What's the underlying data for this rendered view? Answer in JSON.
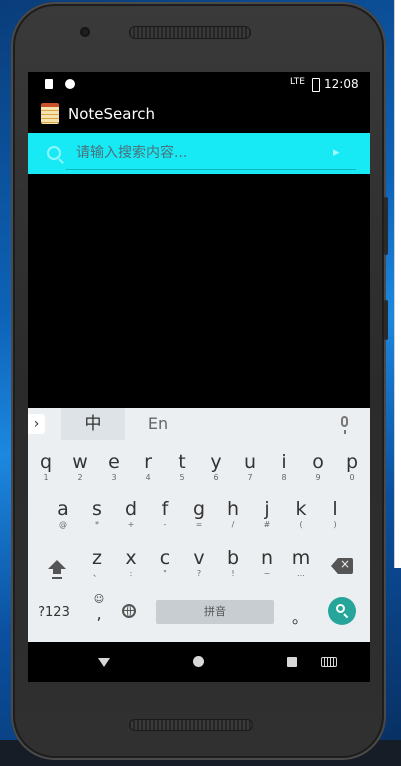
{
  "status_bar": {
    "network": "LTE",
    "time": "12:08"
  },
  "app": {
    "title": "NoteSearch"
  },
  "search": {
    "placeholder": "请输入搜索内容...",
    "value": ""
  },
  "keyboard": {
    "lang_zh": "中",
    "lang_en": "En",
    "expand": "›",
    "rows": [
      [
        {
          "k": "q",
          "s": "1"
        },
        {
          "k": "w",
          "s": "2"
        },
        {
          "k": "e",
          "s": "3"
        },
        {
          "k": "r",
          "s": "4"
        },
        {
          "k": "t",
          "s": "5"
        },
        {
          "k": "y",
          "s": "6"
        },
        {
          "k": "u",
          "s": "7"
        },
        {
          "k": "i",
          "s": "8"
        },
        {
          "k": "o",
          "s": "9"
        },
        {
          "k": "p",
          "s": "0"
        }
      ],
      [
        {
          "k": "a",
          "s": "@"
        },
        {
          "k": "s",
          "s": "*"
        },
        {
          "k": "d",
          "s": "+"
        },
        {
          "k": "f",
          "s": "-"
        },
        {
          "k": "g",
          "s": "="
        },
        {
          "k": "h",
          "s": "/"
        },
        {
          "k": "j",
          "s": "#"
        },
        {
          "k": "k",
          "s": "("
        },
        {
          "k": "l",
          "s": ")"
        }
      ],
      [
        {
          "k": "z",
          "s": "、"
        },
        {
          "k": "x",
          "s": ":"
        },
        {
          "k": "c",
          "s": "\""
        },
        {
          "k": "v",
          "s": "?"
        },
        {
          "k": "b",
          "s": "!"
        },
        {
          "k": "n",
          "s": "~"
        },
        {
          "k": "m",
          "s": "…"
        }
      ]
    ],
    "symbols_label": "?123",
    "emoji_symbol": "☺",
    "comma_label": ",",
    "space_label": "拼音",
    "period_label": "。"
  },
  "colors": {
    "search_bar": "#18eaf5",
    "search_key": "#26a69a",
    "keyboard_bg": "#eceff1"
  }
}
